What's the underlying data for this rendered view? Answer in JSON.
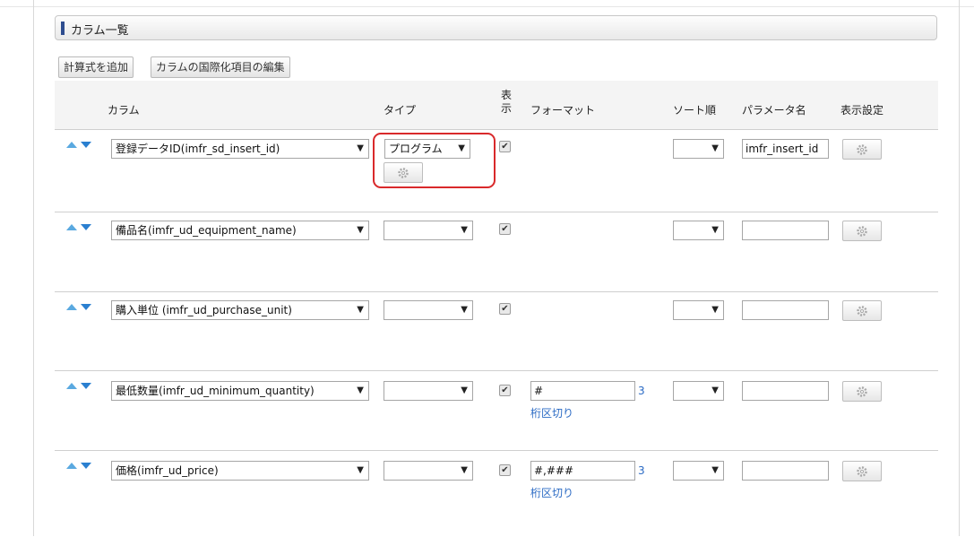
{
  "section": {
    "title": "カラム一覧"
  },
  "toolbar": {
    "add_formula": "計算式を追加",
    "edit_i18n": "カラムの国際化項目の編集"
  },
  "table": {
    "headers": {
      "column": "カラム",
      "type": "タイプ",
      "display_top": "表",
      "display_bottom": "示",
      "format": "フォーマット",
      "sort": "ソート順",
      "param": "パラメータ名",
      "display_settings": "表示設定"
    },
    "rows": [
      {
        "column": "登録データID(imfr_sd_insert_id)",
        "type": "プログラム",
        "param": "imfr_insert_id"
      },
      {
        "column": "備品名(imfr_ud_equipment_name)",
        "type": "",
        "param": ""
      },
      {
        "column": "購入単位 (imfr_ud_purchase_unit)",
        "type": "",
        "param": ""
      },
      {
        "column": "最低数量(imfr_ud_minimum_quantity)",
        "type": "",
        "param": "",
        "format": "#",
        "digits": "3",
        "separator_link": "桁区切り"
      },
      {
        "column": "価格(imfr_ud_price)",
        "type": "",
        "param": "",
        "format": "#,###",
        "digits": "3",
        "separator_link": "桁区切り"
      }
    ]
  }
}
